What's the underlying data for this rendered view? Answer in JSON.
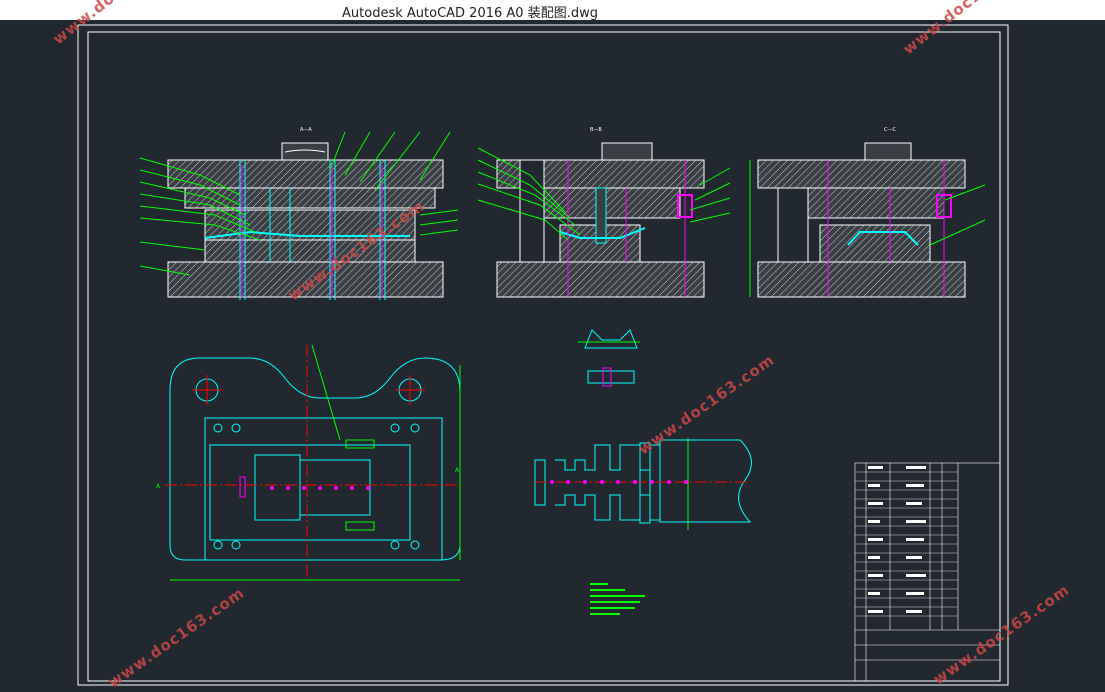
{
  "window": {
    "title": "Autodesk AutoCAD 2016     A0 装配图.dwg"
  },
  "watermark": {
    "text": "www.doc163.com"
  },
  "colors": {
    "background": "#212830",
    "frame": "#ffffff",
    "outline": "#00ffff",
    "leader": "#00ff00",
    "part": "#ff00ff",
    "hatch": "#c8c8c8",
    "watermark": "#cd4646"
  },
  "drawing": {
    "sections": [
      {
        "label": "A—A"
      },
      {
        "label": "B—B"
      },
      {
        "label": "C—C"
      }
    ],
    "view_marks": {
      "a_left": "A",
      "a_right": "A"
    }
  }
}
